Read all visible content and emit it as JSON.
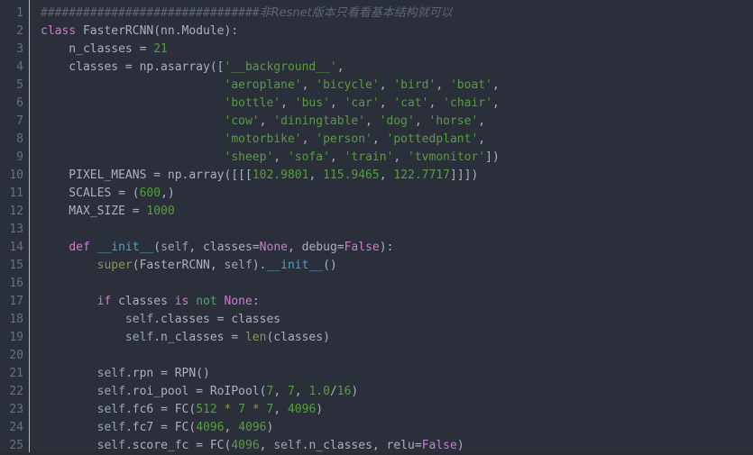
{
  "editor": {
    "theme_name": "dark-python-editor",
    "background_color": "#2b2f3a",
    "gutter_color": "#2b2f3a",
    "line_number_color": "#5c7388",
    "default_text_color": "#a9b1bd",
    "language": "python",
    "first_visible_line": 1,
    "last_visible_line": 25,
    "total_visible_lines": 25,
    "line_height_px": 20,
    "font_size_px": 13
  },
  "palette": {
    "keyword": "#cc7bd4",
    "operator_keyword": "#55a36a",
    "string": "#589c3f",
    "number": "#589c3f",
    "builtin_function": "#8a9a3b",
    "dunder_method": "#4ea1c9",
    "identifier": "#a9b1bd",
    "comment": "#5c6773",
    "gutter_separator": "#b4b8bf"
  },
  "line_numbers": [
    1,
    2,
    3,
    4,
    5,
    6,
    7,
    8,
    9,
    10,
    11,
    12,
    13,
    14,
    15,
    16,
    17,
    18,
    19,
    20,
    21,
    22,
    23,
    24,
    25
  ],
  "code_lines": [
    {
      "n": 1,
      "text": "###############################非Resnet版本只看看基本结构就可以",
      "tokens": [
        {
          "t": "###############################",
          "c": "cmt"
        },
        {
          "t": "非Resnet版本只看看基本结构就可以",
          "c": "cmt-cjk"
        }
      ]
    },
    {
      "n": 2,
      "text": "class FasterRCNN(nn.Module):",
      "tokens": [
        {
          "t": "class",
          "c": "kw"
        },
        {
          "t": " FasterRCNN(nn.Module):",
          "c": "plain"
        }
      ]
    },
    {
      "n": 3,
      "text": "    n_classes = 21",
      "tokens": [
        {
          "t": "    n_classes = ",
          "c": "plain"
        },
        {
          "t": "21",
          "c": "num"
        }
      ]
    },
    {
      "n": 4,
      "text": "    classes = np.asarray(['__background__',",
      "tokens": [
        {
          "t": "    classes = np.asarray([",
          "c": "plain"
        },
        {
          "t": "'__background__'",
          "c": "str"
        },
        {
          "t": ",",
          "c": "plain"
        }
      ]
    },
    {
      "n": 5,
      "text": "                          'aeroplane', 'bicycle', 'bird', 'boat',",
      "tokens": [
        {
          "t": "                          ",
          "c": "plain"
        },
        {
          "t": "'aeroplane'",
          "c": "str"
        },
        {
          "t": ", ",
          "c": "plain"
        },
        {
          "t": "'bicycle'",
          "c": "str"
        },
        {
          "t": ", ",
          "c": "plain"
        },
        {
          "t": "'bird'",
          "c": "str"
        },
        {
          "t": ", ",
          "c": "plain"
        },
        {
          "t": "'boat'",
          "c": "str"
        },
        {
          "t": ",",
          "c": "plain"
        }
      ]
    },
    {
      "n": 6,
      "text": "                          'bottle', 'bus', 'car', 'cat', 'chair',",
      "tokens": [
        {
          "t": "                          ",
          "c": "plain"
        },
        {
          "t": "'bottle'",
          "c": "str"
        },
        {
          "t": ", ",
          "c": "plain"
        },
        {
          "t": "'bus'",
          "c": "str"
        },
        {
          "t": ", ",
          "c": "plain"
        },
        {
          "t": "'car'",
          "c": "str"
        },
        {
          "t": ", ",
          "c": "plain"
        },
        {
          "t": "'cat'",
          "c": "str"
        },
        {
          "t": ", ",
          "c": "plain"
        },
        {
          "t": "'chair'",
          "c": "str"
        },
        {
          "t": ",",
          "c": "plain"
        }
      ]
    },
    {
      "n": 7,
      "text": "                          'cow', 'diningtable', 'dog', 'horse',",
      "tokens": [
        {
          "t": "                          ",
          "c": "plain"
        },
        {
          "t": "'cow'",
          "c": "str"
        },
        {
          "t": ", ",
          "c": "plain"
        },
        {
          "t": "'diningtable'",
          "c": "str"
        },
        {
          "t": ", ",
          "c": "plain"
        },
        {
          "t": "'dog'",
          "c": "str"
        },
        {
          "t": ", ",
          "c": "plain"
        },
        {
          "t": "'horse'",
          "c": "str"
        },
        {
          "t": ",",
          "c": "plain"
        }
      ]
    },
    {
      "n": 8,
      "text": "                          'motorbike', 'person', 'pottedplant',",
      "tokens": [
        {
          "t": "                          ",
          "c": "plain"
        },
        {
          "t": "'motorbike'",
          "c": "str"
        },
        {
          "t": ", ",
          "c": "plain"
        },
        {
          "t": "'person'",
          "c": "str"
        },
        {
          "t": ", ",
          "c": "plain"
        },
        {
          "t": "'pottedplant'",
          "c": "str"
        },
        {
          "t": ",",
          "c": "plain"
        }
      ]
    },
    {
      "n": 9,
      "text": "                          'sheep', 'sofa', 'train', 'tvmonitor'])",
      "tokens": [
        {
          "t": "                          ",
          "c": "plain"
        },
        {
          "t": "'sheep'",
          "c": "str"
        },
        {
          "t": ", ",
          "c": "plain"
        },
        {
          "t": "'sofa'",
          "c": "str"
        },
        {
          "t": ", ",
          "c": "plain"
        },
        {
          "t": "'train'",
          "c": "str"
        },
        {
          "t": ", ",
          "c": "plain"
        },
        {
          "t": "'tvmonitor'",
          "c": "str"
        },
        {
          "t": "])",
          "c": "plain"
        }
      ]
    },
    {
      "n": 10,
      "text": "    PIXEL_MEANS = np.array([[[102.9801, 115.9465, 122.7717]]])",
      "tokens": [
        {
          "t": "    PIXEL_MEANS = np.array([[[",
          "c": "plain"
        },
        {
          "t": "102.9801",
          "c": "num"
        },
        {
          "t": ", ",
          "c": "plain"
        },
        {
          "t": "115.9465",
          "c": "num"
        },
        {
          "t": ", ",
          "c": "plain"
        },
        {
          "t": "122.7717",
          "c": "num"
        },
        {
          "t": "]]])",
          "c": "plain"
        }
      ]
    },
    {
      "n": 11,
      "text": "    SCALES = (600,)",
      "tokens": [
        {
          "t": "    SCALES = (",
          "c": "plain"
        },
        {
          "t": "600",
          "c": "num"
        },
        {
          "t": ",)",
          "c": "plain"
        }
      ]
    },
    {
      "n": 12,
      "text": "    MAX_SIZE = 1000",
      "tokens": [
        {
          "t": "    MAX_SIZE = ",
          "c": "plain"
        },
        {
          "t": "1000",
          "c": "num"
        }
      ]
    },
    {
      "n": 13,
      "text": "",
      "tokens": []
    },
    {
      "n": 14,
      "text": "    def __init__(self, classes=None, debug=False):",
      "tokens": [
        {
          "t": "    ",
          "c": "plain"
        },
        {
          "t": "def",
          "c": "kw"
        },
        {
          "t": " ",
          "c": "plain"
        },
        {
          "t": "__init__",
          "c": "dunder"
        },
        {
          "t": "(",
          "c": "plain"
        },
        {
          "t": "self",
          "c": "selfkw"
        },
        {
          "t": ", classes=",
          "c": "plain"
        },
        {
          "t": "None",
          "c": "kw"
        },
        {
          "t": ", debug=",
          "c": "plain"
        },
        {
          "t": "False",
          "c": "kw"
        },
        {
          "t": "):",
          "c": "plain"
        }
      ]
    },
    {
      "n": 15,
      "text": "        super(FasterRCNN, self).__init__()",
      "tokens": [
        {
          "t": "        ",
          "c": "plain"
        },
        {
          "t": "super",
          "c": "fn"
        },
        {
          "t": "(FasterRCNN, ",
          "c": "plain"
        },
        {
          "t": "self",
          "c": "selfkw"
        },
        {
          "t": ").",
          "c": "plain"
        },
        {
          "t": "__init__",
          "c": "dunder"
        },
        {
          "t": "()",
          "c": "plain"
        }
      ]
    },
    {
      "n": 16,
      "text": "",
      "tokens": []
    },
    {
      "n": 17,
      "text": "        if classes is not None:",
      "tokens": [
        {
          "t": "        ",
          "c": "plain"
        },
        {
          "t": "if",
          "c": "kw"
        },
        {
          "t": " classes ",
          "c": "plain"
        },
        {
          "t": "is",
          "c": "kw"
        },
        {
          "t": " ",
          "c": "plain"
        },
        {
          "t": "not",
          "c": "opkw"
        },
        {
          "t": " ",
          "c": "plain"
        },
        {
          "t": "None",
          "c": "kw"
        },
        {
          "t": ":",
          "c": "plain"
        }
      ]
    },
    {
      "n": 18,
      "text": "            self.classes = classes",
      "tokens": [
        {
          "t": "            ",
          "c": "plain"
        },
        {
          "t": "self",
          "c": "selfkw"
        },
        {
          "t": ".classes = classes",
          "c": "plain"
        }
      ]
    },
    {
      "n": 19,
      "text": "            self.n_classes = len(classes)",
      "tokens": [
        {
          "t": "            ",
          "c": "plain"
        },
        {
          "t": "self",
          "c": "selfkw"
        },
        {
          "t": ".n_classes = ",
          "c": "plain"
        },
        {
          "t": "len",
          "c": "fn"
        },
        {
          "t": "(classes)",
          "c": "plain"
        }
      ]
    },
    {
      "n": 20,
      "text": "",
      "tokens": []
    },
    {
      "n": 21,
      "text": "        self.rpn = RPN()",
      "tokens": [
        {
          "t": "        ",
          "c": "plain"
        },
        {
          "t": "self",
          "c": "selfkw"
        },
        {
          "t": ".rpn = RPN()",
          "c": "plain"
        }
      ]
    },
    {
      "n": 22,
      "text": "        self.roi_pool = RoIPool(7, 7, 1.0/16)",
      "tokens": [
        {
          "t": "        ",
          "c": "plain"
        },
        {
          "t": "self",
          "c": "selfkw"
        },
        {
          "t": ".roi_pool = RoIPool(",
          "c": "plain"
        },
        {
          "t": "7",
          "c": "num"
        },
        {
          "t": ", ",
          "c": "plain"
        },
        {
          "t": "7",
          "c": "num"
        },
        {
          "t": ", ",
          "c": "plain"
        },
        {
          "t": "1.0",
          "c": "num"
        },
        {
          "t": "/",
          "c": "plain"
        },
        {
          "t": "16",
          "c": "num"
        },
        {
          "t": ")",
          "c": "plain"
        }
      ]
    },
    {
      "n": 23,
      "text": "        self.fc6 = FC(512 * 7 * 7, 4096)",
      "tokens": [
        {
          "t": "        ",
          "c": "plain"
        },
        {
          "t": "self",
          "c": "selfkw"
        },
        {
          "t": ".fc6 = FC(",
          "c": "plain"
        },
        {
          "t": "512",
          "c": "num"
        },
        {
          "t": " ",
          "c": "plain"
        },
        {
          "t": "*",
          "c": "star"
        },
        {
          "t": " ",
          "c": "plain"
        },
        {
          "t": "7",
          "c": "num"
        },
        {
          "t": " ",
          "c": "plain"
        },
        {
          "t": "*",
          "c": "star"
        },
        {
          "t": " ",
          "c": "plain"
        },
        {
          "t": "7",
          "c": "num"
        },
        {
          "t": ", ",
          "c": "plain"
        },
        {
          "t": "4096",
          "c": "num"
        },
        {
          "t": ")",
          "c": "plain"
        }
      ]
    },
    {
      "n": 24,
      "text": "        self.fc7 = FC(4096, 4096)",
      "tokens": [
        {
          "t": "        ",
          "c": "plain"
        },
        {
          "t": "self",
          "c": "selfkw"
        },
        {
          "t": ".fc7 = FC(",
          "c": "plain"
        },
        {
          "t": "4096",
          "c": "num"
        },
        {
          "t": ", ",
          "c": "plain"
        },
        {
          "t": "4096",
          "c": "num"
        },
        {
          "t": ")",
          "c": "plain"
        }
      ]
    },
    {
      "n": 25,
      "text": "        self.score_fc = FC(4096, self.n_classes, relu=False)",
      "tokens": [
        {
          "t": "        ",
          "c": "plain"
        },
        {
          "t": "self",
          "c": "selfkw"
        },
        {
          "t": ".score_fc = FC(",
          "c": "plain"
        },
        {
          "t": "4096",
          "c": "num"
        },
        {
          "t": ", ",
          "c": "plain"
        },
        {
          "t": "self",
          "c": "selfkw"
        },
        {
          "t": ".n_classes, relu=",
          "c": "plain"
        },
        {
          "t": "False",
          "c": "kw"
        },
        {
          "t": ")",
          "c": "plain"
        }
      ]
    }
  ]
}
